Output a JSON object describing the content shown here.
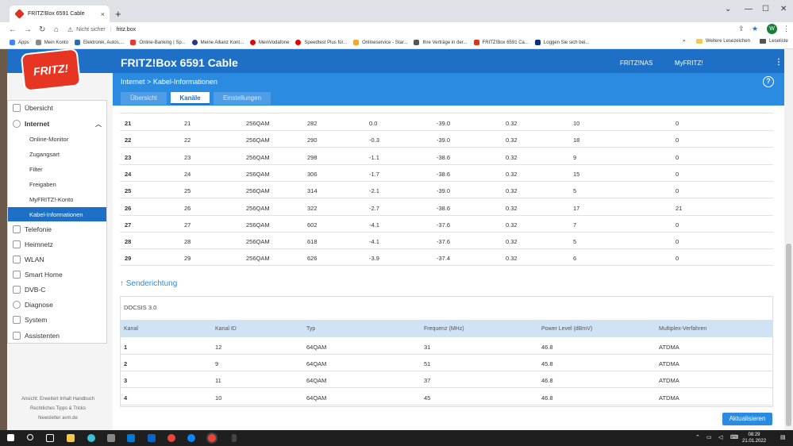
{
  "browser": {
    "tab_title": "FRITZ!Box 6591 Cable",
    "tab_close": "×",
    "new_tab": "+",
    "win_min": "—",
    "win_max": "☐",
    "win_close": "✕",
    "win_chevron": "⌄",
    "nav_back": "←",
    "nav_fwd": "→",
    "nav_reload": "↻",
    "nav_home": "⌂",
    "url_warning": "Nicht sicher",
    "url_host": "fritz.box",
    "avatar_letter": "W",
    "bookmarks": [
      {
        "label": "Apps",
        "color": "#4285f4"
      },
      {
        "label": "Mein Konto",
        "color": "#888888"
      },
      {
        "label": "Elektronik, Autos,...",
        "color": "#2b6cb0"
      },
      {
        "label": "Online-Banking | Sp...",
        "color": "#e53935"
      },
      {
        "label": "Meine Allianz Kont...",
        "color": "#1e3a8a"
      },
      {
        "label": "MeinVodafone",
        "color": "#e60000"
      },
      {
        "label": "Speedtest Plus für...",
        "color": "#e60000"
      },
      {
        "label": "Onlineservice - Star...",
        "color": "#f5a623"
      },
      {
        "label": "Ihre Verträge in der...",
        "color": "#555555"
      },
      {
        "label": "FRITZ!Box 6591 Ca...",
        "color": "#e0301e"
      },
      {
        "label": "Loggen Sie sich bei...",
        "color": "#003087"
      }
    ],
    "bookmarks_more": "»",
    "other_bookmarks": "Weitere Lesezeichen",
    "reading_list": "Leseliste"
  },
  "header": {
    "logo_text": "FRITZ!",
    "title": "FRITZ!Box 6591 Cable",
    "link_nas": "FRITZ!NAS",
    "link_myfritz": "MyFRITZ!",
    "breadcrumb_root": "Internet",
    "breadcrumb_sep": ">",
    "breadcrumb_page": "Kabel-Informationen",
    "help": "?"
  },
  "tabs": [
    "Übersicht",
    "Kanäle",
    "Einstellungen"
  ],
  "nav": {
    "items": [
      {
        "label": "Übersicht"
      },
      {
        "label": "Internet"
      },
      {
        "label": "Online-Monitor"
      },
      {
        "label": "Zugangsart"
      },
      {
        "label": "Filter"
      },
      {
        "label": "Freigaben"
      },
      {
        "label": "MyFRITZ!-Konto"
      },
      {
        "label": "Kabel-Informationen"
      },
      {
        "label": "Telefonie"
      },
      {
        "label": "Heimnetz"
      },
      {
        "label": "WLAN"
      },
      {
        "label": "Smart Home"
      },
      {
        "label": "DVB-C"
      },
      {
        "label": "Diagnose"
      },
      {
        "label": "System"
      },
      {
        "label": "Assistenten"
      }
    ],
    "footer_line1": "Ansicht: Erweitert   Inhalt   Handbuch",
    "footer_line2": "Rechtliches   Tipps & Tricks",
    "footer_line3": "Newsletter   avm.de"
  },
  "downstream_rows": [
    [
      "21",
      "21",
      "256QAM",
      "282",
      "0.0",
      "-39.0",
      "0.32",
      "10",
      "0"
    ],
    [
      "22",
      "22",
      "256QAM",
      "290",
      "-0.3",
      "-39.0",
      "0.32",
      "18",
      "0"
    ],
    [
      "23",
      "23",
      "256QAM",
      "298",
      "-1.1",
      "-38.6",
      "0.32",
      "9",
      "0"
    ],
    [
      "24",
      "24",
      "256QAM",
      "306",
      "-1.7",
      "-38.6",
      "0.32",
      "15",
      "0"
    ],
    [
      "25",
      "25",
      "256QAM",
      "314",
      "-2.1",
      "-39.0",
      "0.32",
      "5",
      "0"
    ],
    [
      "26",
      "26",
      "256QAM",
      "322",
      "-2.7",
      "-38.6",
      "0.32",
      "17",
      "21"
    ],
    [
      "27",
      "27",
      "256QAM",
      "602",
      "-4.1",
      "-37.6",
      "0.32",
      "7",
      "0"
    ],
    [
      "28",
      "28",
      "256QAM",
      "618",
      "-4.1",
      "-37.6",
      "0.32",
      "5",
      "0"
    ],
    [
      "29",
      "29",
      "256QAM",
      "626",
      "-3.9",
      "-37.4",
      "0.32",
      "6",
      "0"
    ]
  ],
  "upstream": {
    "link": "↑ Senderichtung",
    "section_title": "DOCSIS 3.0",
    "headers": [
      "Kanal",
      "Kanal ID",
      "Typ",
      "Frequenz (MHz)",
      "Power Level (dBmV)",
      "Multiplex-Verfahren"
    ],
    "rows": [
      [
        "1",
        "12",
        "64QAM",
        "31",
        "46.8",
        "ATDMA"
      ],
      [
        "2",
        "9",
        "64QAM",
        "51",
        "45.8",
        "ATDMA"
      ],
      [
        "3",
        "11",
        "64QAM",
        "37",
        "46.8",
        "ATDMA"
      ],
      [
        "4",
        "10",
        "64QAM",
        "45",
        "46.8",
        "ATDMA"
      ]
    ]
  },
  "update_button": "Aktualisieren",
  "taskbar": {
    "time": "08:29",
    "date": "21.01.2022"
  }
}
